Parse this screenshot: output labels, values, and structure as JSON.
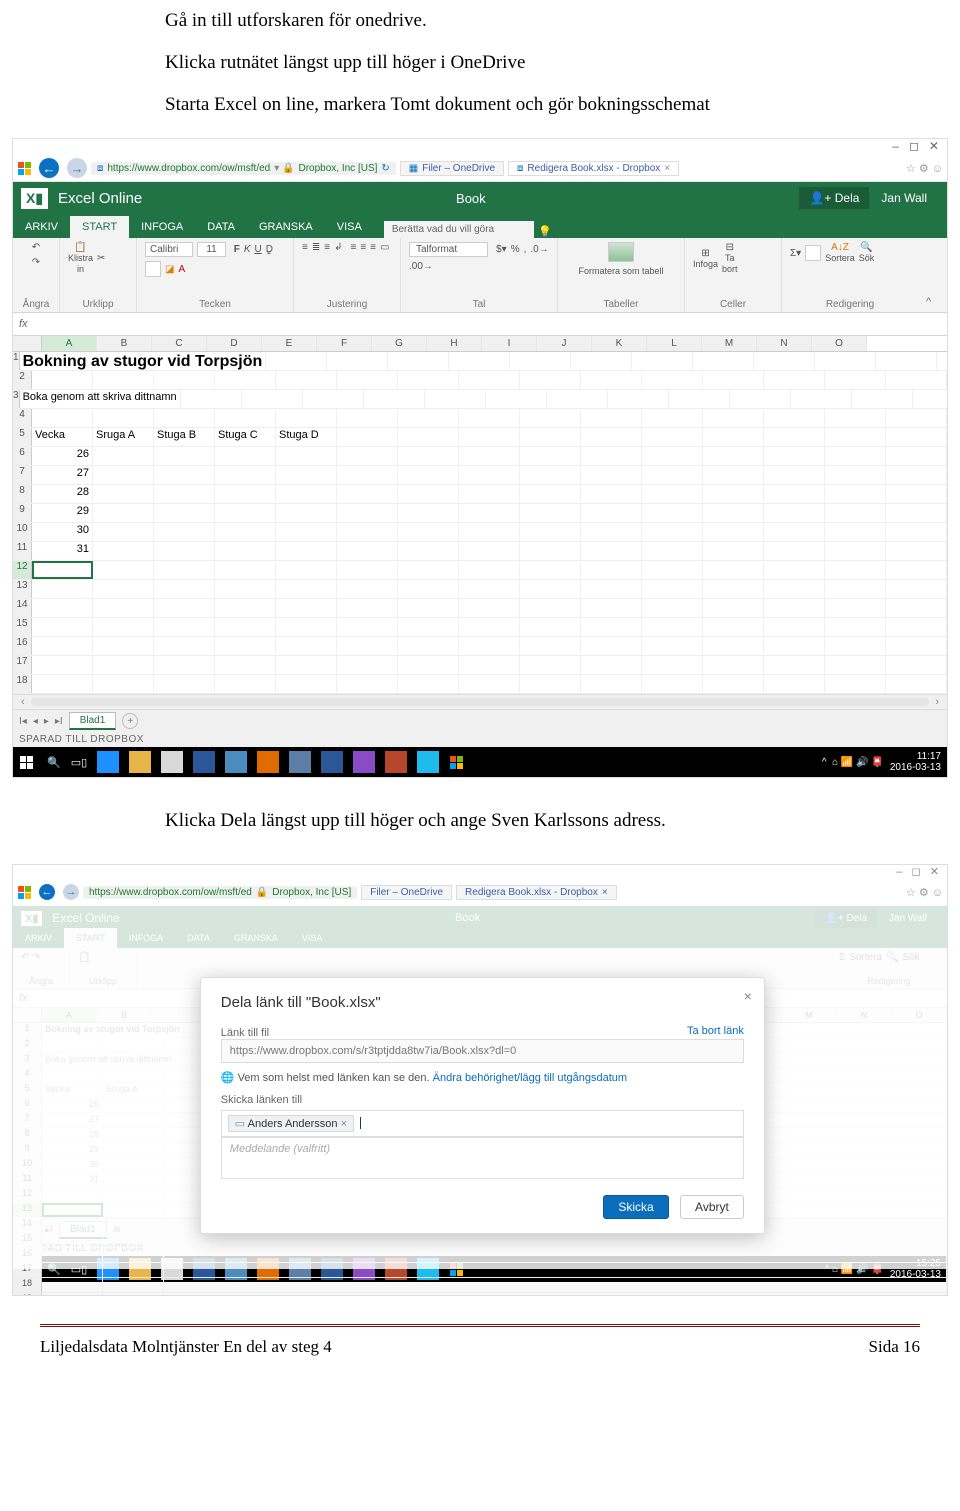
{
  "doc": {
    "p1": "Gå in till utforskaren för onedrive.",
    "p2": "Klicka rutnätet längst upp till höger i OneDrive",
    "p3": "Starta Excel on line, markera Tomt dokument och gör bokningsschemat",
    "p4": "Klicka Dela längst upp till höger och ange Sven Karlssons adress."
  },
  "browser": {
    "url": "https://www.dropbox.com/ow/msft/ed",
    "urlBadge": "Dropbox, Inc [US]",
    "tab1": "Filer – OneDrive",
    "tab2": "Redigera Book.xlsx - Dropbox"
  },
  "excel": {
    "brand": "Excel Online",
    "docTitle": "Book",
    "share": "Dela",
    "user": "Jan Wall",
    "tabs": [
      "ARKIV",
      "START",
      "INFOGA",
      "DATA",
      "GRANSKA",
      "VISA"
    ],
    "tellme": "Berätta vad du vill göra",
    "groups": {
      "undo": "Ångra",
      "clipboard": "Urklipp",
      "font": "Tecken",
      "align": "Justering",
      "number": "Tal",
      "tables": "Tabeller",
      "cells": "Celler",
      "editing": "Redigering"
    },
    "ribbon_items": {
      "paste": "Klistra\nin",
      "font_name": "Calibri",
      "font_size": "11",
      "numfmt": "Talformat",
      "fmt_table": "Formatera som tabell",
      "insert": "Infoga",
      "delete": "Ta\nbort",
      "sort": "Sortera",
      "find": "Sök"
    },
    "fx": "fx",
    "cols": [
      "A",
      "B",
      "C",
      "D",
      "E",
      "F",
      "G",
      "H",
      "I",
      "J",
      "K",
      "L",
      "M",
      "N",
      "O"
    ],
    "rows": [
      {
        "n": "1",
        "A": "Bokning av stugor vid Torpsjön",
        "bold": true,
        "big": true
      },
      {
        "n": "2"
      },
      {
        "n": "3",
        "A": "Boka genom att skriva dittnamn"
      },
      {
        "n": "4"
      },
      {
        "n": "5",
        "A": "Vecka",
        "B": "Sruga A",
        "C": "Stuga B",
        "D": "Stuga C",
        "E": "Stuga D"
      },
      {
        "n": "6",
        "A": "26"
      },
      {
        "n": "7",
        "A": "27"
      },
      {
        "n": "8",
        "A": "28"
      },
      {
        "n": "9",
        "A": "29"
      },
      {
        "n": "10",
        "A": "30"
      },
      {
        "n": "11",
        "A": "31"
      },
      {
        "n": "12",
        "sel": true
      },
      {
        "n": "13"
      },
      {
        "n": "14"
      },
      {
        "n": "15"
      },
      {
        "n": "16"
      },
      {
        "n": "17"
      },
      {
        "n": "18"
      }
    ],
    "sheet": "Blad1",
    "status": "SPARAD TILL DROPBOX"
  },
  "dialog": {
    "title": "Dela länk till \"Book.xlsx\"",
    "linkLabel": "Länk till fil",
    "removeLink": "Ta bort länk",
    "url": "https://www.dropbox.com/s/r3tptjdda8tw7ia/Book.xlsx?dl=0",
    "hintPrefix": "Vem som helst med länken kan se den.",
    "hintLink": "Ändra behörighet/lägg till utgångsdatum",
    "sendLabel": "Skicka länken till",
    "chip": "Anders Andersson",
    "msgPlaceholder": "Meddelande (valfritt)",
    "send": "Skicka",
    "cancel": "Avbryt"
  },
  "taskbar": {
    "time1": "11:17",
    "date1": "2016-03-13",
    "time2": "15:25",
    "date2": "2016-03-13"
  },
  "footer": {
    "left": "Liljedalsdata Molntjänster En del av steg 4",
    "right": "Sida 16"
  }
}
